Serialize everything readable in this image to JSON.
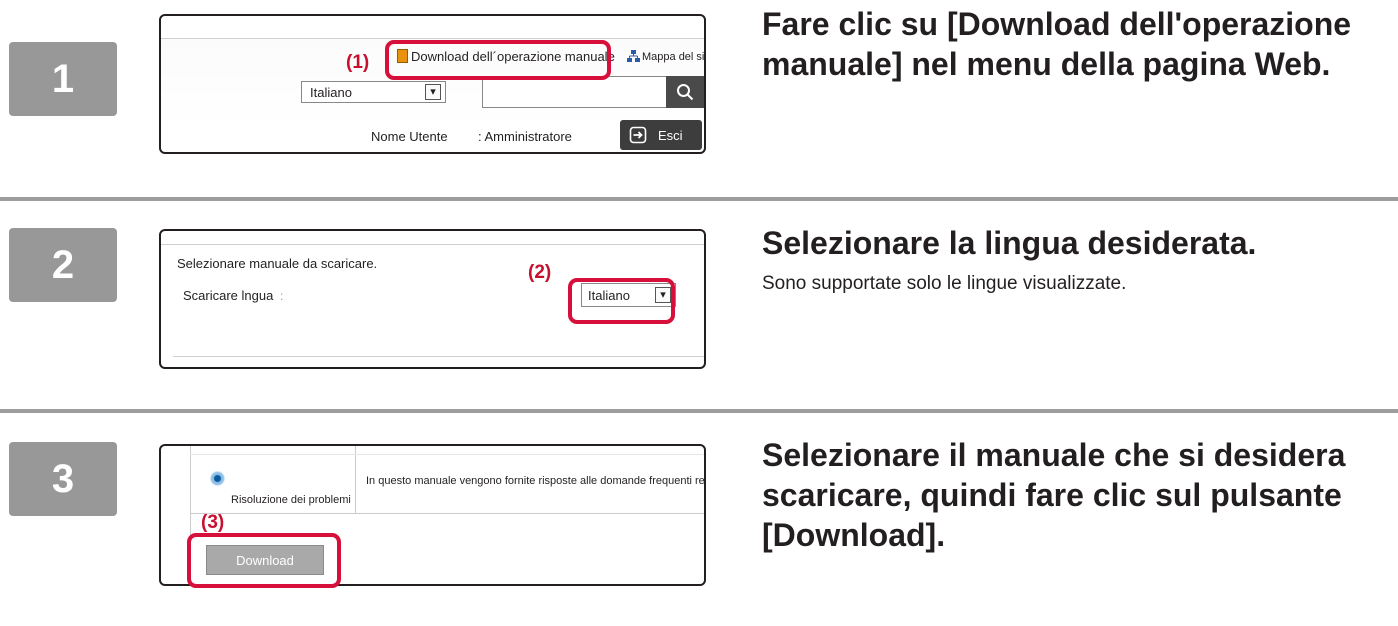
{
  "steps": [
    {
      "number": "1",
      "heading_line1": "Fare clic su [Download dell'operazione",
      "heading_line2": "manuale] nel menu della pagina Web.",
      "screenshot": {
        "callout": "(1)",
        "manual_link": "Download dell´operazione manuale",
        "sitemap_link": "Mappa del sito",
        "language_value": "Italiano",
        "search_value": "",
        "user_label": "Nome Utente",
        "user_value": ": Amministratore",
        "logout_label": "Esci"
      }
    },
    {
      "number": "2",
      "heading": "Selezionare la lingua desiderata.",
      "description": "Sono supportate solo le lingue visualizzate.",
      "screenshot": {
        "callout": "(2)",
        "title": "Selezionare manuale da scaricare.",
        "language_label": "Scaricare lngua",
        "language_colon": ":",
        "language_value": "Italiano"
      }
    },
    {
      "number": "3",
      "heading_line1": "Selezionare il manuale che si desidera",
      "heading_line2": "scaricare, quindi fare clic sul pulsante",
      "heading_line3": "[Download].",
      "screenshot": {
        "callout": "(3)",
        "row_title": "Risoluzione dei problemi",
        "row_description": "In questo manuale vengono fornite risposte alle domande frequenti rela",
        "download_button": "Download"
      }
    }
  ],
  "colors": {
    "badge": "#989898",
    "highlight": "#d6103a",
    "callout": "#c8102e",
    "divider": "#9d9d9d"
  },
  "icons": [
    "manual-book-icon",
    "sitemap-icon",
    "search-icon",
    "logout-icon",
    "chevron-down-icon",
    "radio-icon"
  ]
}
